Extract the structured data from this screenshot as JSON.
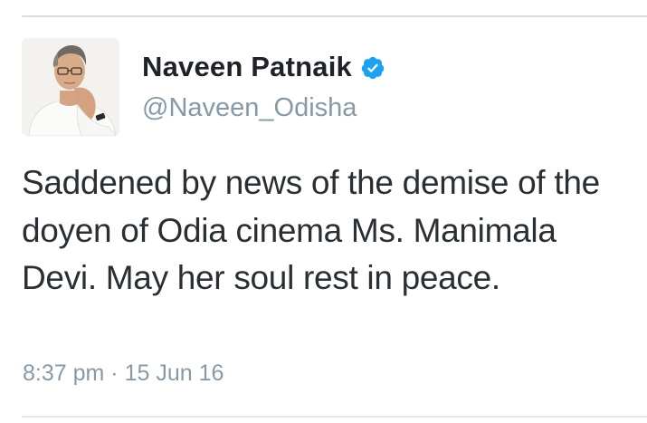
{
  "tweet": {
    "display_name": "Naveen Patnaik",
    "verified": true,
    "handle": "@Naveen_Odisha",
    "text": "Saddened by news of the demise of the doyen of Odia cinema Ms. Manimala Devi. May her soul rest in peace.",
    "time": "8:37 pm",
    "separator": "·",
    "date": "15 Jun 16"
  },
  "icons": {
    "verified": "verified-badge-icon",
    "avatar": "profile-photo"
  },
  "colors": {
    "verified_blue": "#1da1f2",
    "name_text": "#1f2327",
    "secondary_text": "#8899a6",
    "body_text": "#292f33"
  }
}
